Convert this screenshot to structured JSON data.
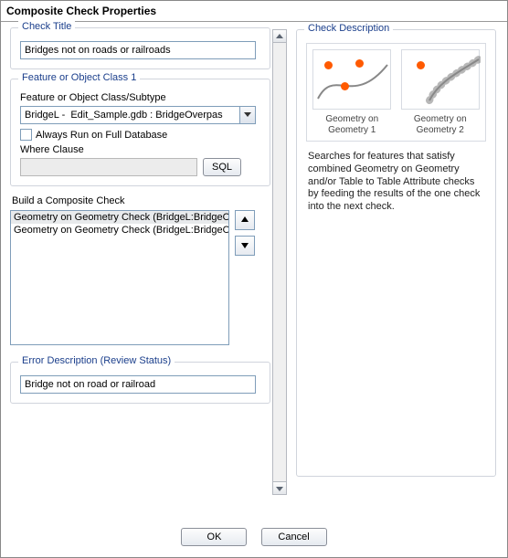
{
  "window": {
    "title": "Composite Check Properties"
  },
  "check_title": {
    "legend": "Check Title",
    "value": "Bridges not on roads or railroads"
  },
  "feature_class": {
    "legend": "Feature or Object Class 1",
    "label": "Feature or Object Class/Subtype",
    "value": "BridgeL -  Edit_Sample.gdb : BridgeOverpas",
    "always_run_label": "Always Run on Full Database",
    "always_run_checked": false,
    "where_label": "Where Clause",
    "where_value": "",
    "sql_button": "SQL"
  },
  "composite": {
    "title": "Build a Composite Check",
    "rows": [
      "Geometry on Geometry Check (BridgeL:BridgeOver",
      "Geometry on Geometry Check (BridgeL:BridgeOver"
    ],
    "selected_index": 0
  },
  "error_desc": {
    "legend": "Error Description (Review Status)",
    "value": "Bridge not on road or railroad"
  },
  "description": {
    "legend": "Check Description",
    "thumbs": [
      {
        "label": "Geometry on\nGeometry 1"
      },
      {
        "label": "Geometry on\nGeometry 2"
      }
    ],
    "text": "Searches for features that satisfy combined Geometry on Geometry and/or Table to Table Attribute checks by feeding the results of the one check into the next check."
  },
  "footer": {
    "ok": "OK",
    "cancel": "Cancel"
  }
}
